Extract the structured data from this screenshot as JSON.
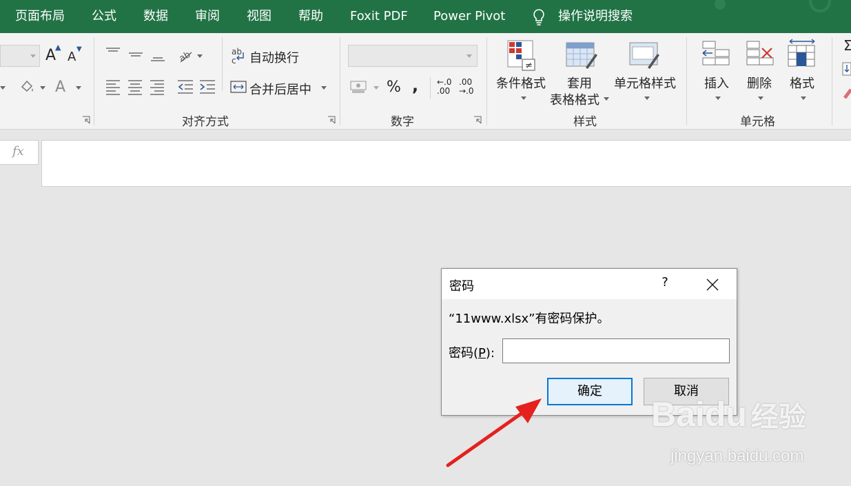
{
  "tabs": [
    "页面布局",
    "公式",
    "数据",
    "审阅",
    "视图",
    "帮助",
    "Foxit PDF",
    "Power Pivot"
  ],
  "search": {
    "label": "操作说明搜索",
    "icon": "lightbulb-icon"
  },
  "ribbon": {
    "font": {
      "grow_label": "A",
      "shrink_label": "A",
      "font_color_label": "A"
    },
    "alignment": {
      "wrap_text": "自动换行",
      "merge_center": "合并后居中",
      "group_label": "对齐方式"
    },
    "number": {
      "percent": "%",
      "comma": ",",
      "inc_decimal_top": "←.0",
      "inc_decimal_bottom": ".00",
      "dec_decimal_top": ".00",
      "dec_decimal_bottom": "→.0",
      "group_label": "数字"
    },
    "styles": {
      "conditional": "条件格式",
      "table_line1": "套用",
      "table_line2": "表格格式",
      "cell_styles": "单元格样式",
      "group_label": "样式"
    },
    "cells": {
      "insert": "插入",
      "delete": "删除",
      "format": "格式",
      "group_label": "单元格"
    },
    "editing": {
      "sum_symbol": "Σ"
    }
  },
  "formula_bar": {
    "fx": "fx",
    "value": ""
  },
  "dialog": {
    "title": "密码",
    "help": "?",
    "message": "“11www.xlsx”有密码保护。",
    "password_label_pre": "密码(",
    "password_label_key": "P",
    "password_label_post": "):",
    "password_value": "",
    "ok": "确定",
    "cancel": "取消"
  },
  "watermark": {
    "brand": "Baidu",
    "brand_cn": "经验",
    "url": "jingyan.baidu.com"
  },
  "colors": {
    "ribbon_tab": "#217346",
    "accent_blue": "#0078d7",
    "arrow_red": "#e5211d"
  }
}
